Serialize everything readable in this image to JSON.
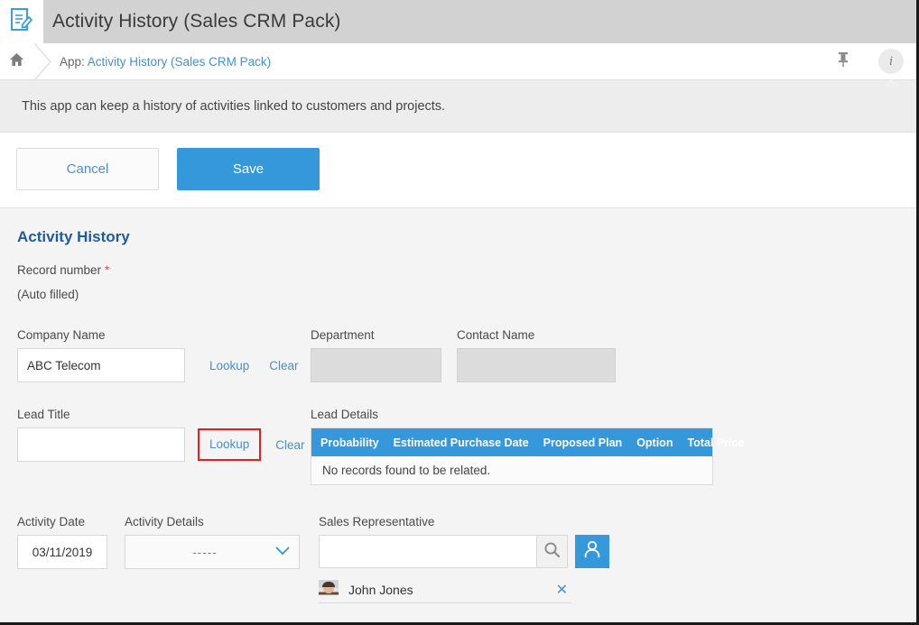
{
  "window": {
    "app_icon": "document-edit-icon",
    "title": "Activity History (Sales CRM Pack)"
  },
  "breadcrumb": {
    "home_icon": "home-icon",
    "prefix": "App:",
    "link": "Activity History (Sales CRM Pack)",
    "pin_icon": "pin-icon",
    "info_icon": "info-icon",
    "info_glyph": "i"
  },
  "description": {
    "text": "This app can keep a history of activities linked to customers and projects."
  },
  "toolbar": {
    "cancel_label": "Cancel",
    "save_label": "Save"
  },
  "form": {
    "title": "Activity History",
    "marker_dot": ".",
    "record_number": {
      "label": "Record number",
      "required_mark": "*",
      "value": "(Auto filled)"
    },
    "company_name": {
      "label": "Company Name",
      "value": "ABC Telecom",
      "placeholder": "",
      "lookup_label": "Lookup",
      "clear_label": "Clear"
    },
    "department": {
      "label": "Department",
      "value": ""
    },
    "contact_name": {
      "label": "Contact Name",
      "value": ""
    },
    "lead_title": {
      "label": "Lead Title",
      "value": "",
      "placeholder": "",
      "lookup_label": "Lookup",
      "clear_label": "Clear",
      "highlight_color": "#e02020"
    },
    "lead_details": {
      "label": "Lead Details",
      "columns": [
        "Probability",
        "Estimated Purchase Date",
        "Proposed Plan",
        "Option",
        "Total Price"
      ],
      "empty_message": "No records found to be related.",
      "header_color": "#3498db"
    },
    "activity_date": {
      "label": "Activity Date",
      "value": "03/11/2019"
    },
    "activity_details": {
      "label": "Activity Details",
      "selected": "-----",
      "chevron_icon": "chevron-down-icon"
    },
    "sales_representative": {
      "label": "Sales Representative",
      "search_value": "",
      "search_placeholder": "",
      "search_icon": "search-icon",
      "person_button_icon": "person-icon",
      "selected": {
        "name": "John Jones",
        "avatar": "user-avatar",
        "remove_icon": "close-icon"
      }
    }
  },
  "colors": {
    "accent_blue": "#3498db",
    "link_blue": "#4a90c4",
    "title_blue": "#1f5c99",
    "titlebar_gray": "#d2d2d2",
    "form_bg": "#f4f4f4",
    "disabled_field": "#dcdcdc"
  }
}
